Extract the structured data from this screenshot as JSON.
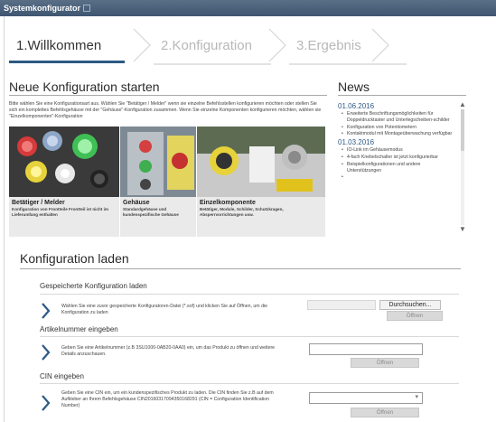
{
  "window": {
    "title": "Systemkonfigurator"
  },
  "wizard": {
    "steps": [
      "1.Willkommen",
      "2.Konfiguration",
      "3.Ergebnis"
    ]
  },
  "start": {
    "title": "Neue Konfiguration starten",
    "intro": "Bitte wählen Sie eine Konfigurationsart aus. Wählen Sie \"Betätiger / Melder\" wenn sie einzelne Befehlsstellen konfigurieren möchten oder stellen Sie sich ein komplettes Befehlsgehäuse mit der \"Gehäuse\"-Konfiguration zusammen. Wenn Sie einzelne Komponenten konfigurieren möchten, wählen sie \"Einzelkomponenten\"-Konfiguration",
    "tiles": [
      {
        "title": "Betätiger / Melder",
        "text": "Konfiguration von Frontteile Frontteil ist nicht im Lieferumfang enthalten"
      },
      {
        "title": "Gehäuse",
        "text": "Standardgehäuse und kundenspezifische Gehäuse"
      },
      {
        "title": "Einzelkomponente",
        "text": "Betätiger, Module, Schilder, Schutzkragen, Absperrvorrichtungen usw."
      }
    ]
  },
  "news": {
    "title": "News",
    "groups": [
      {
        "date": "01.06.2016",
        "items": [
          "Erweiterte Beschriftungsmöglichkeiten für Doppeldrucktaster und Unterlegscheiben-schilder",
          "Konfiguration von Potentiometern",
          "Kontaktmodul mit Montageüberwachung verfügbar"
        ]
      },
      {
        "date": "01.03.2016",
        "items": [
          "IO-Link im Gehäusemodus",
          "4-fach Knebelschalter ist jetzt konfigurierbar",
          "Beispielkonfigurationen und andere Unterstützungen",
          ""
        ]
      }
    ]
  },
  "load": {
    "title": "Konfiguration laden",
    "saved": {
      "title": "Gespeicherte Konfiguration laden",
      "text": "Wählen Sie eine zuvor gespeicherte Konfiguratoren-Datei (*.sof) und klicken Sie auf Öffnen, um die Konfiguration zu laden",
      "browse_label": "Durchsuchen...",
      "open_label": "Öffnen"
    },
    "article": {
      "title": "Artikelnummer eingeben",
      "text": "Geben Sie eine Artikelnummer (z.B 3SU1000-0AB20-0AA0) ein, um das Produkt zu öffnen und weitere Details anzuschauen.",
      "open_label": "Öffnen"
    },
    "cin": {
      "title": "CIN eingeben",
      "text": "Geben Sie eine CIN ein, um ein kundenspezifisches Produkt zu laden. Die CIN finden Sie z.B auf dem Aufkleber an Ihrem Befehlsgehäuse CIN20160317094350168291 (CIN = Configuration Identification Number)",
      "open_label": "Öffnen"
    }
  },
  "colors": {
    "accent": "#2c5a85",
    "titlebar": "#4a6078"
  }
}
